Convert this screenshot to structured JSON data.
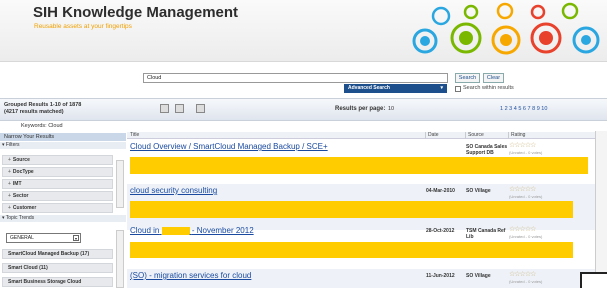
{
  "header": {
    "title": "SIH Knowledge Management",
    "tagline": "Reusable assets at your fingertips"
  },
  "search": {
    "value": "Cloud",
    "advanced_label": "Advanced Search",
    "search_button": "Search",
    "clear_button": "Clear",
    "within_label": "Search within results"
  },
  "results_bar": {
    "grouped": "Grouped Results 1-10 of 1878",
    "matched": "(4217 results matched)",
    "per_page_label": "Results per page:",
    "per_page_value": "10",
    "pager": "1 2 3 4 5 6 7 8 9 10"
  },
  "keywords": "Keywords: Cloud",
  "sidebar": {
    "narrow_header": "Narrow Your Results",
    "filters_label": "▾ Filters",
    "facets": [
      "Source",
      "DocType",
      "IMT",
      "Sector",
      "Customer"
    ],
    "trends_label": "▾ Topic Trends",
    "general_select": "GENERAL",
    "trends": [
      "SmartCloud Managed Backup (17)",
      "Smart Cloud (11)",
      "Smart Business Storage Cloud"
    ]
  },
  "columns": {
    "title": "Title",
    "date": "Date",
    "source": "Source",
    "rating": "Rating"
  },
  "rows": [
    {
      "title": "Cloud Overview / SmartCloud Managed Backup / SCE+",
      "date": "",
      "source": "SO Canada Sales Support DB",
      "rating": "(Unrated - 0 votes)"
    },
    {
      "title": "cloud security consulting",
      "date": "04-Mar-2010",
      "source": "SO Village",
      "rating": "(Unrated - 0 votes)"
    },
    {
      "title_pre": "Cloud in",
      "title_post": "- November 2012",
      "date": "28-Oct-2012",
      "source": "TSM Canada Ref Lib",
      "rating": "(Unrated - 0 votes)"
    },
    {
      "title": "(SO) - migration services for cloud",
      "date": "11-Jun-2012",
      "source": "SO Village",
      "rating": "(Unrated - 0 votes)"
    }
  ],
  "colors": {
    "accent": "#1d4f8c",
    "tagline": "#f0a000",
    "redaction": "#ffcc00",
    "link": "#1a4aa0"
  }
}
